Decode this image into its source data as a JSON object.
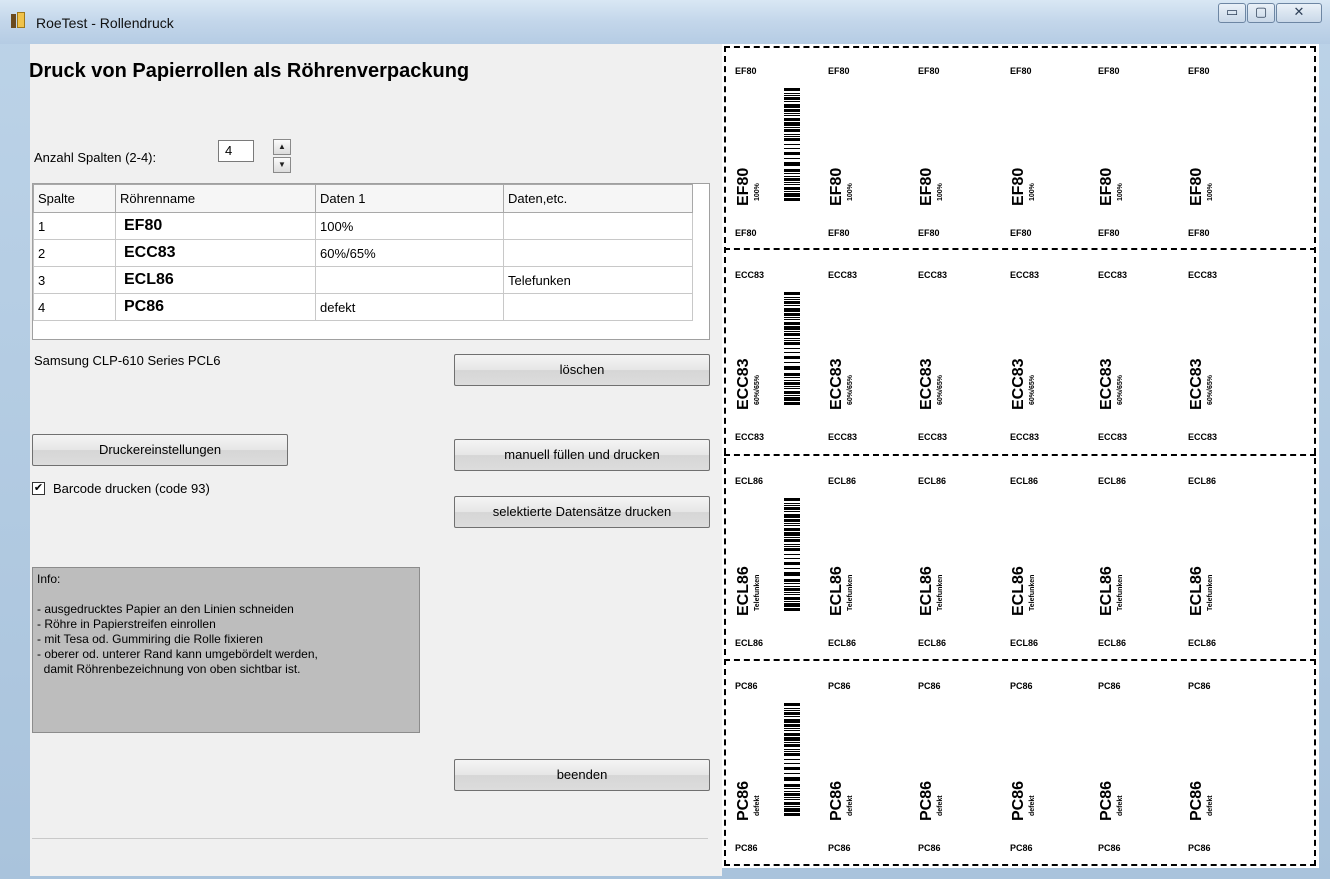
{
  "window": {
    "title": "RoeTest - Rollendruck",
    "buttons": {
      "minimize": "▭",
      "maximize": "▢",
      "close": "✕"
    }
  },
  "heading": "Druck von Papierrollen als Röhrenverpackung",
  "columns_control": {
    "label": "Anzahl Spalten (2-4):",
    "value": "4",
    "up": "▲",
    "down": "▼"
  },
  "table": {
    "headers": [
      "Spalte",
      "Röhrenname",
      "Daten 1",
      "Daten,etc."
    ],
    "rows": [
      {
        "spalte": "1",
        "name": "EF80",
        "daten1": "100%",
        "daten_etc": ""
      },
      {
        "spalte": "2",
        "name": "ECC83",
        "daten1": "60%/65%",
        "daten_etc": ""
      },
      {
        "spalte": "3",
        "name": "ECL86",
        "daten1": "",
        "daten_etc": "Telefunken"
      },
      {
        "spalte": "4",
        "name": "PC86",
        "daten1": "defekt",
        "daten_etc": ""
      }
    ]
  },
  "printer_name": "Samsung CLP-610 Series PCL6",
  "buttons": {
    "loeschen": "löschen",
    "druckereinstellungen": "Druckereinstellungen",
    "manuell": "manuell füllen und drucken",
    "selektiert": "selektierte Datensätze drucken",
    "beenden": "beenden"
  },
  "barcode_checkbox": {
    "label": "Barcode drucken (code 93)",
    "checked": true,
    "mark": "✔"
  },
  "info": {
    "title": "Info:",
    "lines": [
      "- ausgedrucktes Papier an den Linien schneiden",
      "- Röhre in Papierstreifen einrollen",
      "- mit Tesa od. Gummiring die Rolle fixieren",
      "- oberer od. unterer Rand kann umgebördelt werden,",
      "  damit Röhrenbezeichnung von oben sichtbar ist."
    ]
  },
  "preview": {
    "rows": [
      {
        "name": "EF80",
        "data": "100%"
      },
      {
        "name": "ECC83",
        "data": "60%/65%"
      },
      {
        "name": "ECL86",
        "data": "Telefunken"
      },
      {
        "name": "PC86",
        "data": "defekt"
      }
    ],
    "labels_per_row": 6
  }
}
